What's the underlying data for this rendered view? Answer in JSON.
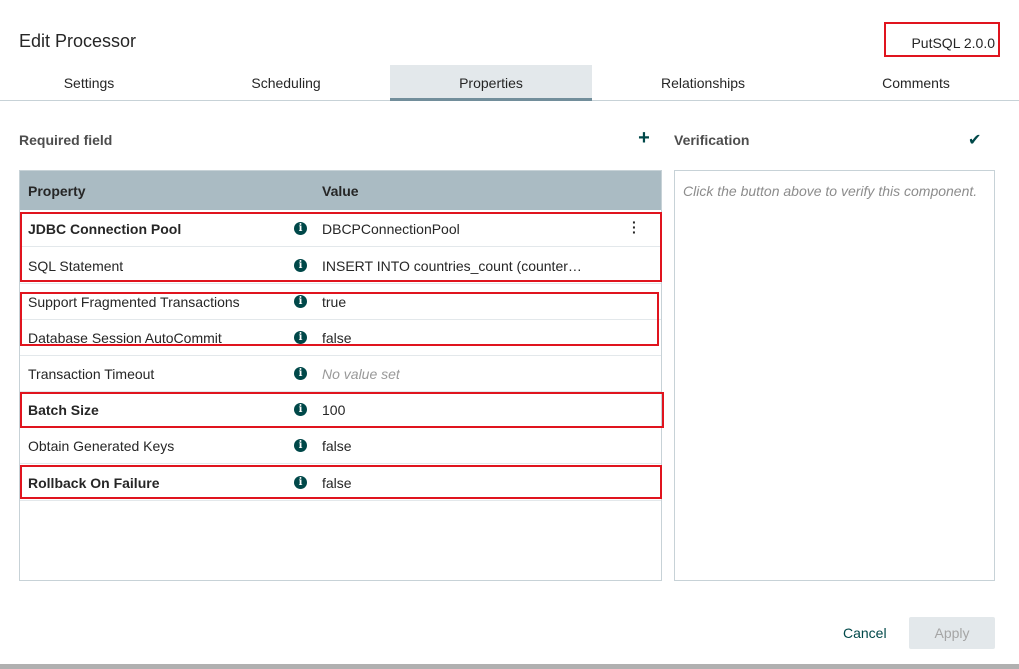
{
  "dialog": {
    "title": "Edit Processor",
    "version": "PutSQL 2.0.0"
  },
  "tabs": [
    {
      "label": "Settings"
    },
    {
      "label": "Scheduling"
    },
    {
      "label": "Properties",
      "active": true
    },
    {
      "label": "Relationships"
    },
    {
      "label": "Comments"
    }
  ],
  "properties": {
    "required_label": "Required field",
    "add_icon": "plus-icon",
    "columns": {
      "property": "Property",
      "value": "Value"
    },
    "rows": [
      {
        "name": "JDBC Connection Pool",
        "required": true,
        "value": "DBCPConnectionPool",
        "value_set": true
      },
      {
        "name": "SQL Statement",
        "required": false,
        "value": "INSERT INTO countries_count (counter…",
        "value_set": true
      },
      {
        "name": "Support Fragmented Transactions",
        "required": false,
        "value": "true",
        "value_set": true
      },
      {
        "name": "Database Session AutoCommit",
        "required": false,
        "value": "false",
        "value_set": true
      },
      {
        "name": "Transaction Timeout",
        "required": false,
        "value": "No value set",
        "value_set": false
      },
      {
        "name": "Batch Size",
        "required": true,
        "value": "100",
        "value_set": true
      },
      {
        "name": "Obtain Generated Keys",
        "required": false,
        "value": "false",
        "value_set": true
      },
      {
        "name": "Rollback On Failure",
        "required": true,
        "value": "false",
        "value_set": true
      }
    ]
  },
  "verification": {
    "label": "Verification",
    "icon": "check-icon",
    "message": "Click the button above to verify this component."
  },
  "footer": {
    "cancel_label": "Cancel",
    "apply_label": "Apply"
  },
  "colors": {
    "accent": "#004849",
    "header_bg": "#aabbc3",
    "highlight": "#e0141e"
  }
}
